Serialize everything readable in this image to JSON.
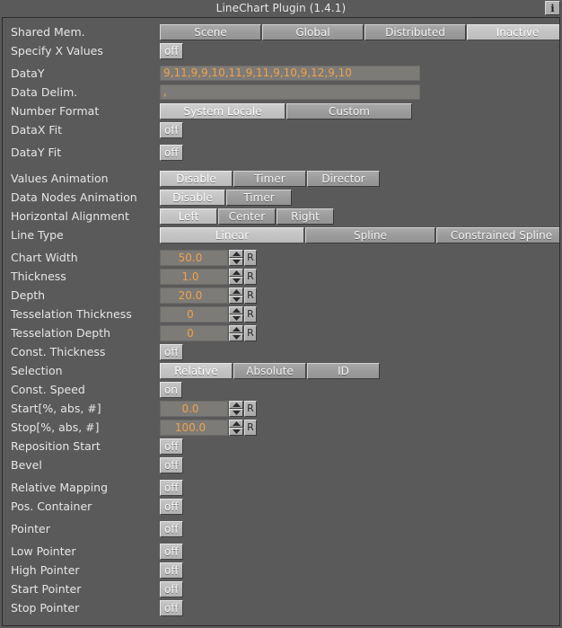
{
  "window": {
    "title": "LineChart Plugin (1.4.1)",
    "info_button": "i"
  },
  "colors": {
    "panel_bg": "#5a5a5a",
    "value_text": "#f0a24a",
    "field_bg": "#7d7b77",
    "button_face": "#9c9c9c",
    "button_selected": "#c3c3c3",
    "label_text": "#e6e6e6"
  },
  "rows": {
    "shared_mem": {
      "label": "Shared Mem.",
      "options": [
        "Scene",
        "Global",
        "Distributed",
        "Inactive"
      ],
      "selected": "Inactive"
    },
    "specify_x_values": {
      "label": "Specify X Values",
      "value": "off"
    },
    "data_y": {
      "label": "DataY",
      "value": "9,11,9,9,10,11,9,11,9,10,9,12,9,10"
    },
    "data_delim": {
      "label": "Data Delim.",
      "value": ","
    },
    "number_format": {
      "label": "Number Format",
      "options": [
        "System Locale",
        "Custom"
      ],
      "selected": "System Locale"
    },
    "datax_fit": {
      "label": "DataX Fit",
      "value": "off"
    },
    "datay_fit": {
      "label": "DataY Fit",
      "value": "off"
    },
    "values_animation": {
      "label": "Values Animation",
      "options": [
        "Disable",
        "Timer",
        "Director"
      ],
      "selected": "Disable"
    },
    "data_nodes_animation": {
      "label": "Data Nodes Animation",
      "options": [
        "Disable",
        "Timer"
      ],
      "selected": "Disable"
    },
    "horizontal_alignment": {
      "label": "Horizontal Alignment",
      "options": [
        "Left",
        "Center",
        "Right"
      ],
      "selected": "Left"
    },
    "line_type": {
      "label": "Line Type",
      "options": [
        "Linear",
        "Spline",
        "Constrained Spline"
      ],
      "selected": "Linear"
    },
    "chart_width": {
      "label": "Chart Width",
      "value": "50.0",
      "reset": "R"
    },
    "thickness": {
      "label": "Thickness",
      "value": "1.0",
      "reset": "R"
    },
    "depth": {
      "label": "Depth",
      "value": "20.0",
      "reset": "R"
    },
    "tesselation_thickness": {
      "label": "Tesselation Thickness",
      "value": "0",
      "reset": "R"
    },
    "tesselation_depth": {
      "label": "Tesselation Depth",
      "value": "0",
      "reset": "R"
    },
    "const_thickness": {
      "label": "Const. Thickness",
      "value": "off"
    },
    "selection": {
      "label": "Selection",
      "options": [
        "Relative",
        "Absolute",
        "ID"
      ],
      "selected": "Relative"
    },
    "const_speed": {
      "label": "Const. Speed",
      "value": "on"
    },
    "start": {
      "label": "Start[%, abs, #]",
      "value": "0.0",
      "reset": "R"
    },
    "stop": {
      "label": "Stop[%, abs, #]",
      "value": "100.0",
      "reset": "R"
    },
    "reposition_start": {
      "label": "Reposition Start",
      "value": "off"
    },
    "bevel": {
      "label": "Bevel",
      "value": "off"
    },
    "relative_mapping": {
      "label": "Relative Mapping",
      "value": "off"
    },
    "pos_container": {
      "label": "Pos. Container",
      "value": "off"
    },
    "pointer": {
      "label": "Pointer",
      "value": "off"
    },
    "low_pointer": {
      "label": "Low Pointer",
      "value": "off"
    },
    "high_pointer": {
      "label": "High Pointer",
      "value": "off"
    },
    "start_pointer": {
      "label": "Start Pointer",
      "value": "off"
    },
    "stop_pointer": {
      "label": "Stop Pointer",
      "value": "off"
    }
  }
}
